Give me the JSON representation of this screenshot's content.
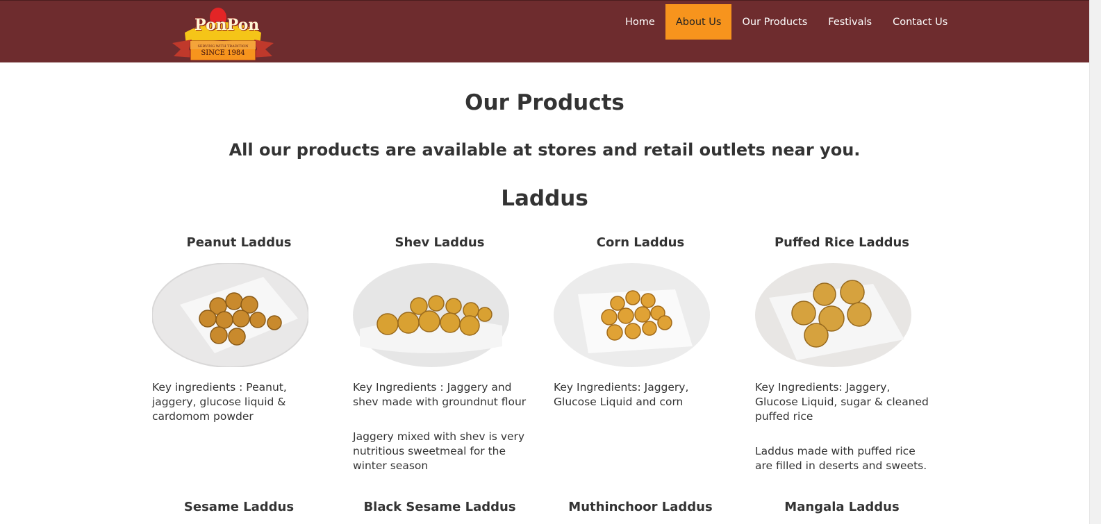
{
  "header": {
    "logo": {
      "brand": "PonPon",
      "tagline": "SERVING WITH TRADITION",
      "since": "SINCE 1984"
    },
    "nav": [
      {
        "label": "Home",
        "active": false
      },
      {
        "label": "About Us",
        "active": true
      },
      {
        "label": "Our Products",
        "active": false
      },
      {
        "label": "Festivals",
        "active": false
      },
      {
        "label": "Contact Us",
        "active": false
      }
    ]
  },
  "colors": {
    "header_bg": "#6e2c2e",
    "active_nav_bg": "#f7941d",
    "text": "#333333"
  },
  "main": {
    "title": "Our Products",
    "subtitle": "All our products are available at stores and retail outlets near you.",
    "section_title": "Laddus",
    "products": [
      {
        "name": "Peanut Laddus",
        "ingredients": "Key ingredients : Peanut, jaggery, glucose liquid & cardomom powder",
        "description": ""
      },
      {
        "name": "Shev Laddus",
        "ingredients": "Key Ingredients : Jaggery and shev made with groundnut flour",
        "description": "Jaggery mixed with shev is very nutritious sweetmeal for the winter season"
      },
      {
        "name": "Corn Laddus",
        "ingredients": "Key Ingredients: Jaggery, Glucose Liquid and corn",
        "description": ""
      },
      {
        "name": "Puffed Rice Laddus",
        "ingredients": "Key Ingredients: Jaggery, Glucose Liquid, sugar & cleaned puffed rice",
        "description": "Laddus made with puffed rice are filled in deserts and sweets."
      }
    ],
    "next_row": [
      {
        "name": "Sesame Laddus"
      },
      {
        "name": "Black Sesame Laddus"
      },
      {
        "name": "Muthinchoor Laddus"
      },
      {
        "name": "Mangala Laddus"
      }
    ]
  }
}
